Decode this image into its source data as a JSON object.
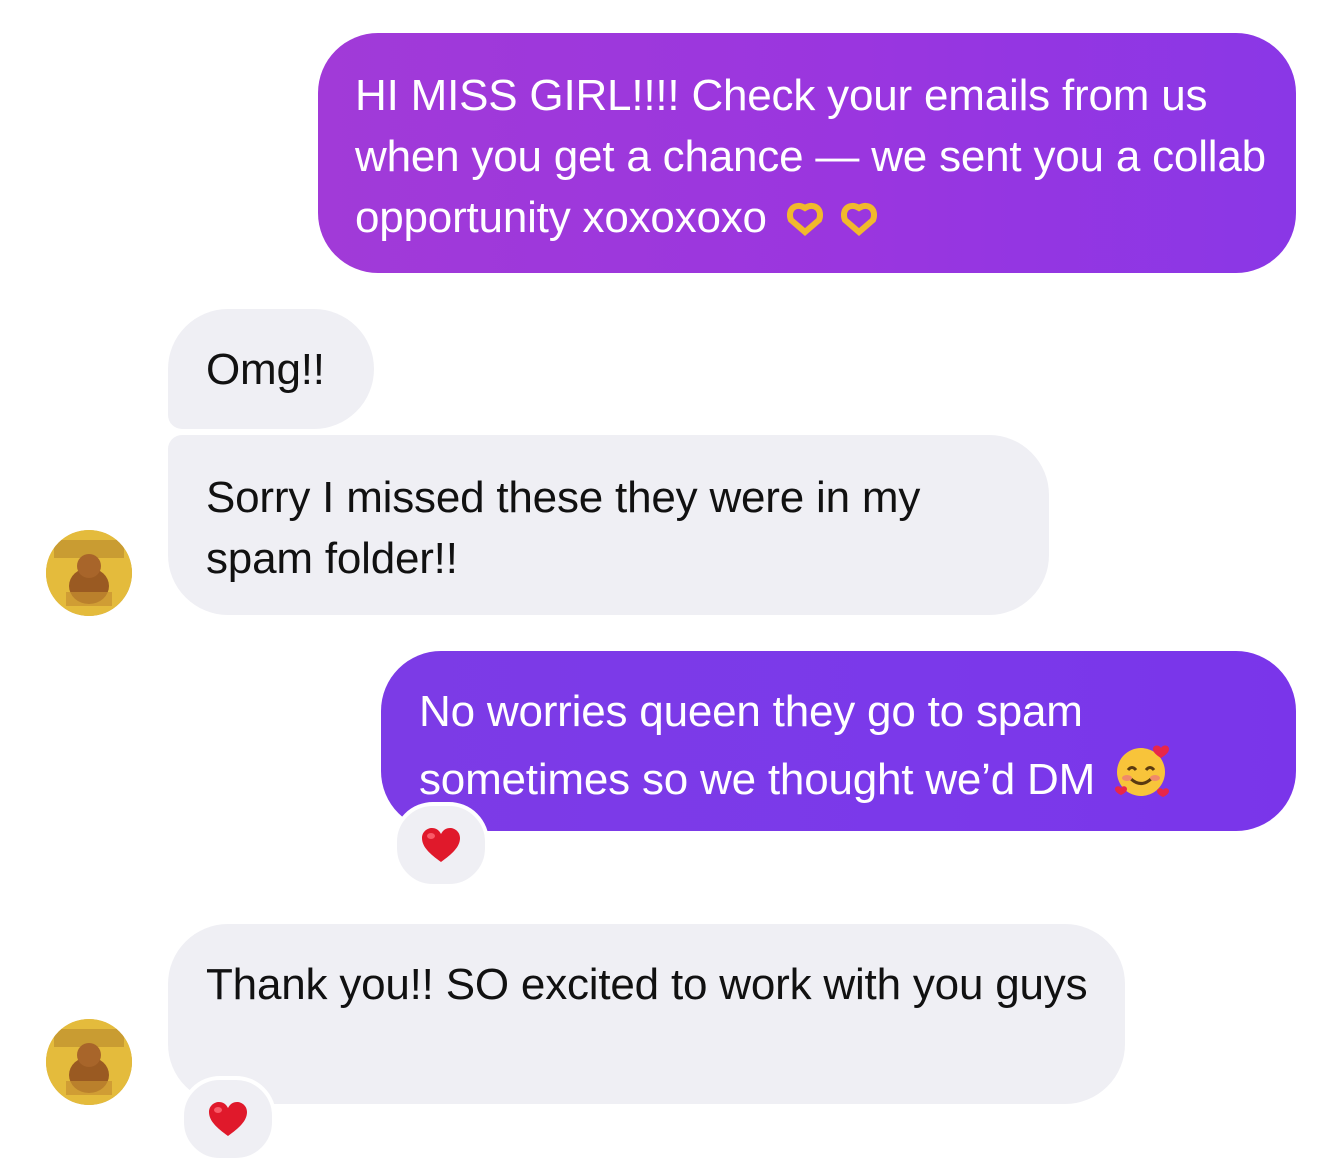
{
  "conversation": {
    "messages": [
      {
        "from": "sent",
        "text": "HI MISS GIRL!!!! Check your emails from us when you get a chance — we sent you a collab opportunity xoxoxoxo",
        "emoji": "heart-hands-emoji x2"
      },
      {
        "from": "received",
        "text": "Omg!!"
      },
      {
        "from": "received",
        "text": "Sorry I missed these they were in my spam folder!!"
      },
      {
        "from": "sent",
        "text": "No worries queen they go to spam sometimes so we thought we’d DM",
        "emoji": "smiling-face-with-hearts-emoji",
        "reaction": "red-heart"
      },
      {
        "from": "received",
        "text": "Thank you!! SO excited to work with you guys",
        "reaction": "red-heart"
      }
    ]
  },
  "colors": {
    "sent_bubble_1": "#9a36df",
    "sent_bubble_2": "#7b39ea",
    "received_bubble": "#efeff4",
    "reaction_heart": "#e0192b"
  }
}
